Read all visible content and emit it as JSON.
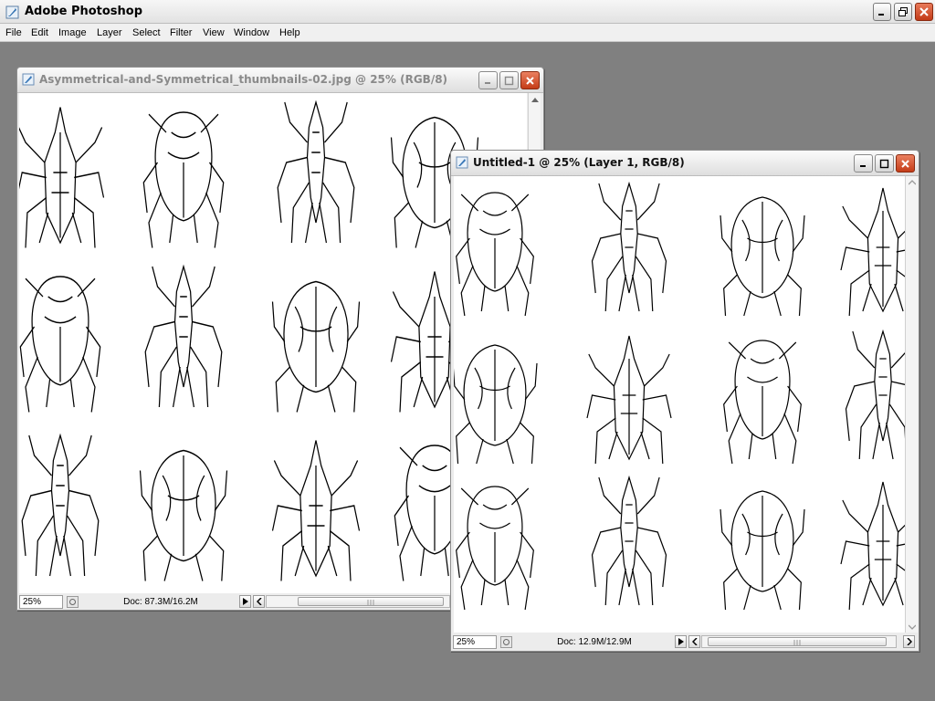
{
  "app": {
    "title": "Adobe Photoshop",
    "icon": "photoshop-feather-icon",
    "controls": [
      "minimize-icon",
      "restore-icon",
      "close-icon"
    ]
  },
  "menu": [
    {
      "label": "File"
    },
    {
      "label": "Edit"
    },
    {
      "label": "Image"
    },
    {
      "label": "Layer"
    },
    {
      "label": "Select"
    },
    {
      "label": "Filter"
    },
    {
      "label": "View"
    },
    {
      "label": "Window"
    },
    {
      "label": "Help"
    }
  ],
  "documents": [
    {
      "title": "Asymmetrical-and-Symmetrical_thumbnails-02.jpg @ 25% (RGB/8)",
      "zoom": "25%",
      "doc_size": "Doc: 87.3M/16.2M",
      "active": false
    },
    {
      "title": "Untitled-1 @ 25% (Layer 1, RGB/8)",
      "zoom": "25%",
      "doc_size": "Doc: 12.9M/12.9M",
      "active": true
    }
  ],
  "colors": {
    "desktop": "#808080",
    "close_button": "#c23a17"
  }
}
